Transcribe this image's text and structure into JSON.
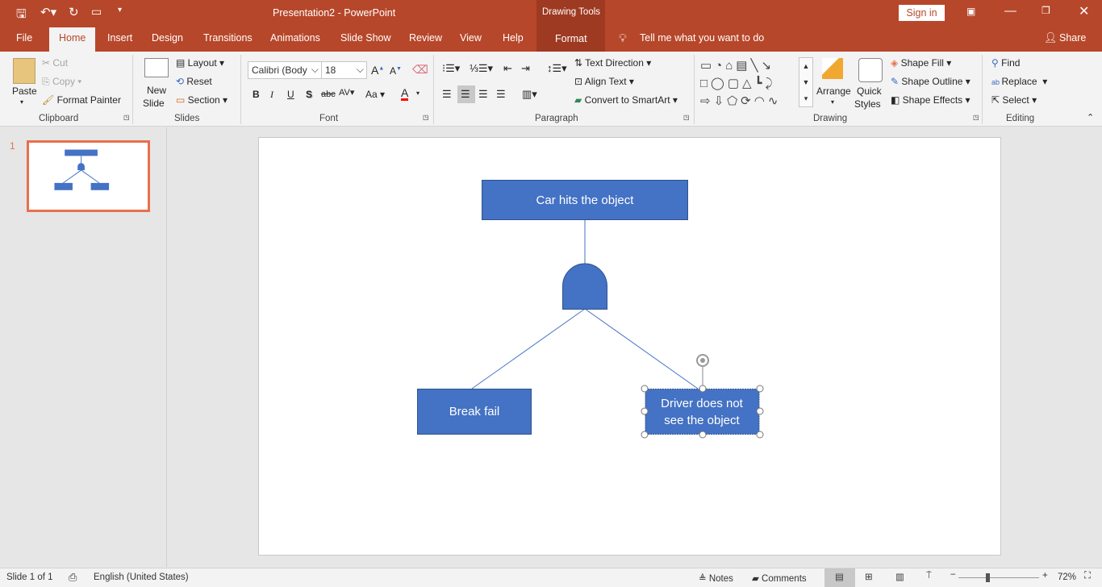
{
  "window": {
    "title": "Presentation2  -  PowerPoint",
    "context_label": "Drawing Tools",
    "sign_in": "Sign in"
  },
  "tabs": [
    "File",
    "Home",
    "Insert",
    "Design",
    "Transitions",
    "Animations",
    "Slide Show",
    "Review",
    "View",
    "Help",
    "Format"
  ],
  "tell_me": "Tell me what you want to do",
  "share": "Share",
  "ribbon": {
    "clipboard": {
      "paste": "Paste",
      "cut": "Cut",
      "copy": "Copy",
      "format_painter": "Format Painter",
      "label": "Clipboard"
    },
    "slides": {
      "new_slide": "New",
      "new_slide2": "Slide",
      "layout": "Layout",
      "reset": "Reset",
      "section": "Section",
      "label": "Slides"
    },
    "font": {
      "font_name": "Calibri (Body",
      "font_size": "18",
      "label": "Font",
      "font_color": "#ff0000"
    },
    "paragraph": {
      "text_direction": "Text Direction",
      "align_text": "Align Text",
      "smartart": "Convert to SmartArt",
      "label": "Paragraph"
    },
    "drawing": {
      "arrange": "Arrange",
      "quick": "Quick",
      "styles": "Styles",
      "shape_fill": "Shape Fill",
      "shape_outline": "Shape Outline",
      "shape_effects": "Shape Effects",
      "label": "Drawing"
    },
    "editing": {
      "find": "Find",
      "replace": "Replace",
      "select": "Select",
      "label": "Editing"
    }
  },
  "slides_pane": {
    "number": "1"
  },
  "slide": {
    "top_box": "Car hits the object",
    "left_box": "Break fail",
    "right_box_line1": "Driver does not",
    "right_box_line2": "see the object",
    "shape_fill": "#4472c4",
    "shape_border": "#2f528f"
  },
  "status": {
    "slide_count": "Slide 1 of 1",
    "language": "English (United States)",
    "notes": "Notes",
    "comments": "Comments",
    "zoom": "72%",
    "zoom_fraction": 0.72
  },
  "colors": {
    "accent": "#b7472a",
    "thumbnail_border": "#e8704d"
  }
}
